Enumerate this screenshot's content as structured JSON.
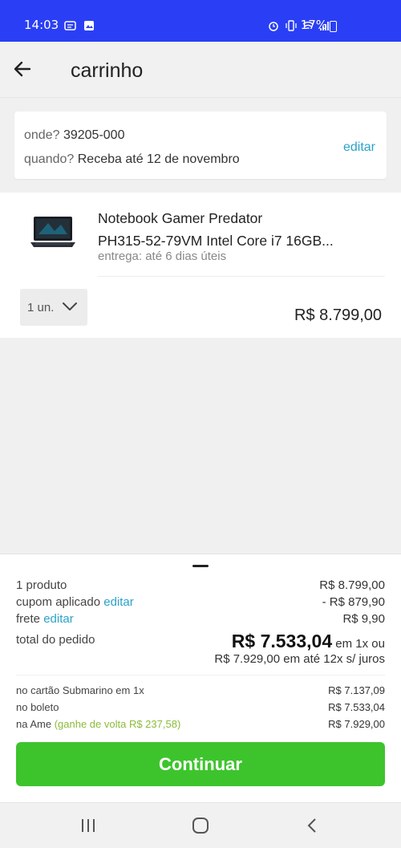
{
  "status_bar": {
    "time": "14:03",
    "battery": "17%",
    "icons": [
      "whatsapp-icon",
      "gallery-icon",
      "alarm-icon",
      "vibrate-icon",
      "wifi-icon",
      "signal-icon",
      "battery-icon"
    ]
  },
  "header": {
    "title": "carrinho",
    "back_icon": "arrow-left-icon"
  },
  "delivery_info": {
    "where_label": "onde?",
    "where_value": "39205-000",
    "when_label": "quando?",
    "when_value": "Receba até 12 de novembro",
    "edit_label": "editar"
  },
  "cart_item": {
    "name_line1": "Notebook Gamer Predator",
    "name_line2": "PH315-52-79VM Intel Core i7 16GB...",
    "delivery": "entrega: até 6 dias úteis",
    "quantity": "1 un.",
    "price": "R$ 8.799,00"
  },
  "summary": {
    "products_label": "1 produto",
    "products_value": "R$ 8.799,00",
    "coupon_label": "cupom aplicado",
    "coupon_edit": "editar",
    "coupon_value": "- R$ 879,90",
    "shipping_label": "frete",
    "shipping_edit": "editar",
    "shipping_value": "R$ 9,90",
    "total_label": "total do pedido",
    "total_value": "R$ 7.533,04",
    "total_suffix": "em 1x ou",
    "installments": "R$ 7.929,00 em até 12x s/ juros",
    "payments": [
      {
        "label": "no cartão Submarino em 1x",
        "cashback": "",
        "value": "R$ 7.137,09"
      },
      {
        "label": "no boleto",
        "cashback": "",
        "value": "R$ 7.533,04"
      },
      {
        "label": "na Ame",
        "cashback": "(ganhe de volta R$ 237,58)",
        "value": "R$ 7.929,00"
      }
    ],
    "continue_label": "Continuar"
  },
  "colors": {
    "status_bar": "#2a3ff5",
    "link": "#2ba3c9",
    "discount": "#8bbb3a",
    "primary_button": "#3dc42d"
  },
  "nav_bar": {
    "icons": [
      "recent-apps-icon",
      "home-icon",
      "back-icon"
    ]
  }
}
